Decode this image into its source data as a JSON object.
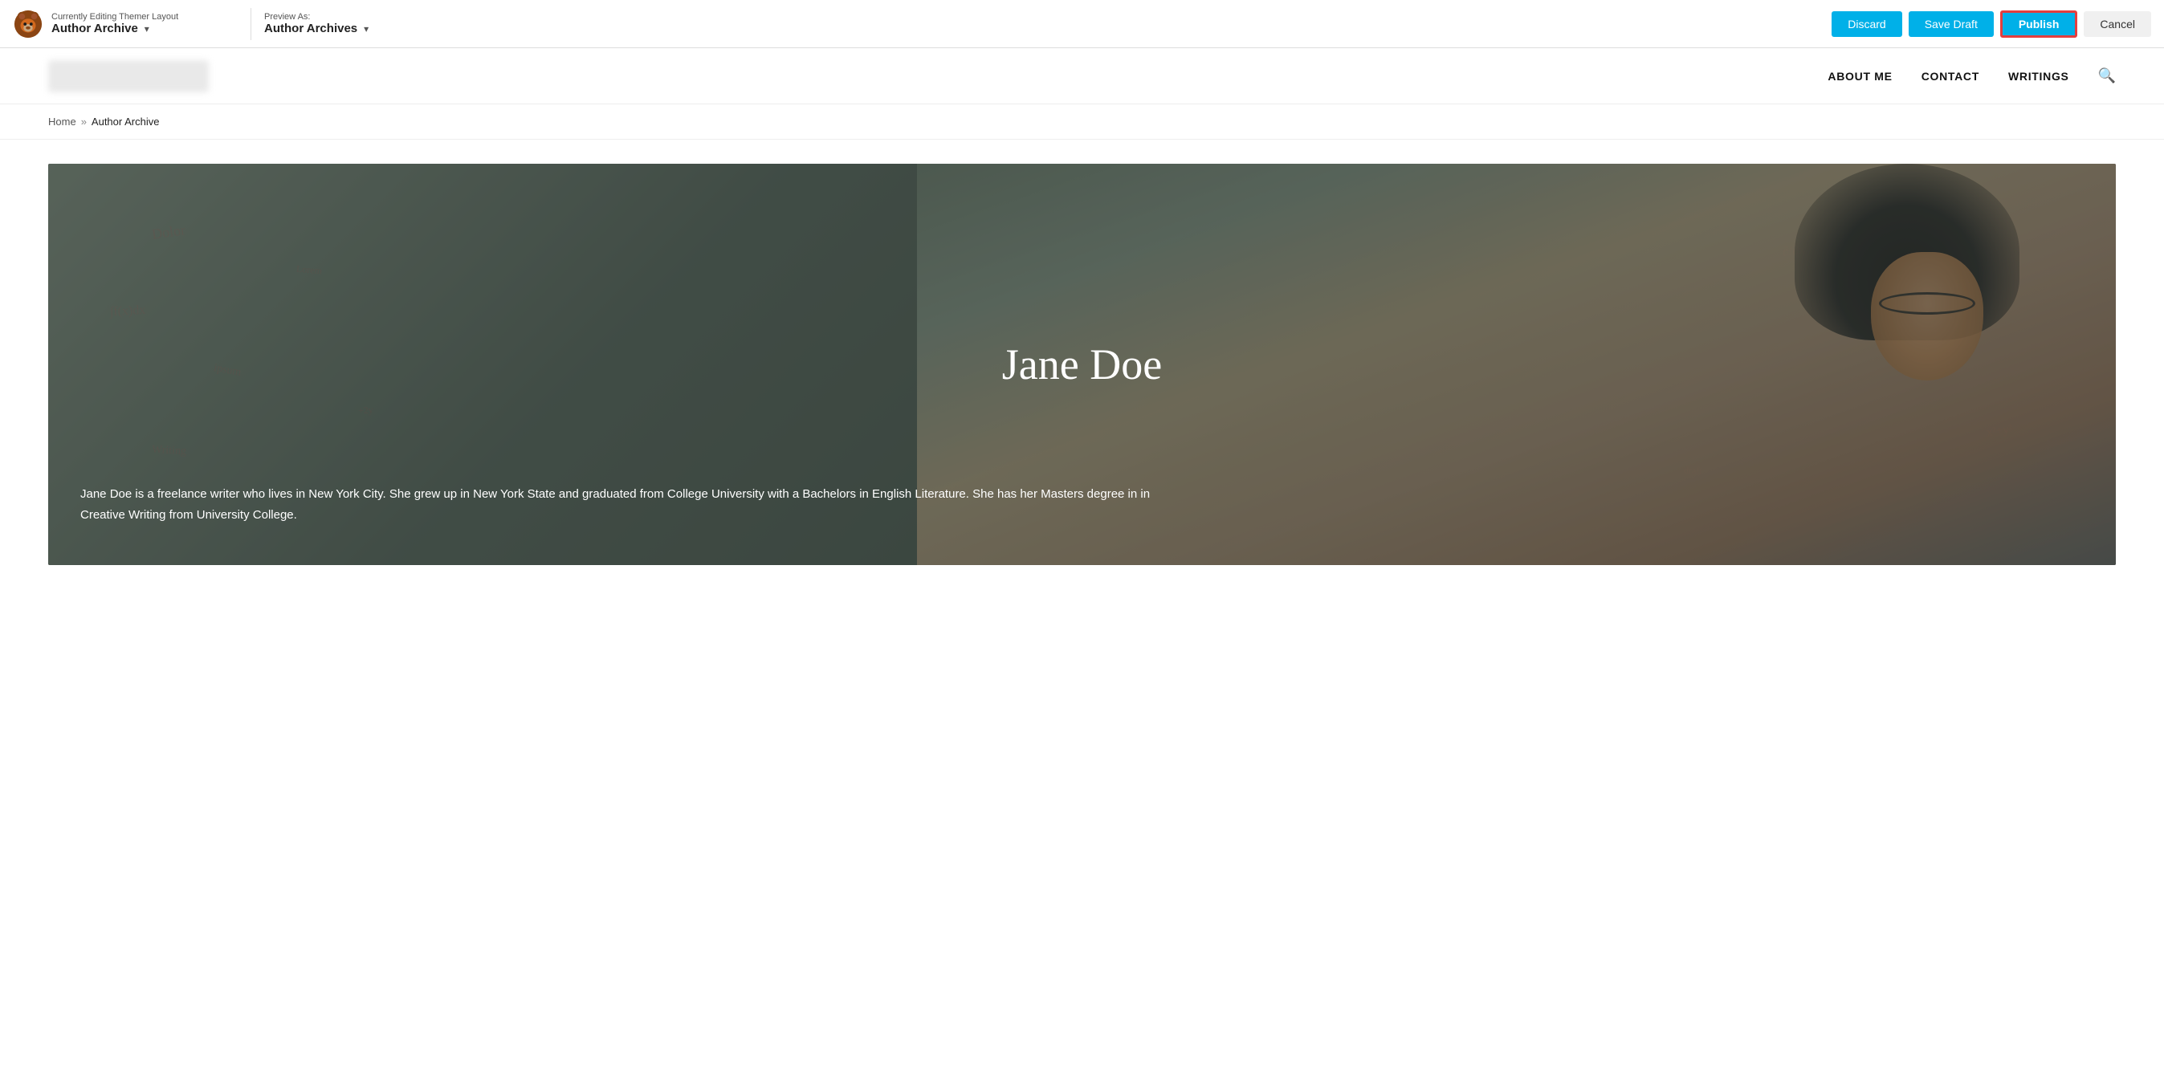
{
  "admin_bar": {
    "editing_label": "Currently Editing Themer Layout",
    "editing_title": "Author Archive",
    "preview_label": "Preview As:",
    "preview_value": "Author Archives",
    "discard_label": "Discard",
    "save_draft_label": "Save Draft",
    "publish_label": "Publish",
    "cancel_label": "Cancel"
  },
  "site_nav": {
    "links": [
      {
        "label": "ABOUT ME"
      },
      {
        "label": "CONTACT"
      },
      {
        "label": "WRITINGS"
      }
    ]
  },
  "breadcrumb": {
    "home": "Home",
    "separator": "»",
    "current": "Author Archive"
  },
  "hero": {
    "name": "Jane Doe",
    "bio": "Jane Doe is a freelance writer who lives in New York City. She grew up in New York State and graduated from College University with a Bachelors in English Literature. She has her Masters degree in in Creative Writing from University College."
  }
}
